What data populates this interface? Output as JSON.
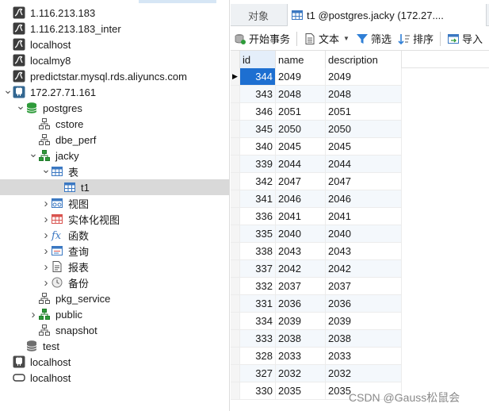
{
  "tree": {
    "nodes": [
      {
        "label": "1.116.213.183",
        "icon": "mysql-connection-icon",
        "level": 0,
        "expander": ""
      },
      {
        "label": "1.116.213.183_inter",
        "icon": "mysql-connection-icon",
        "level": 0,
        "expander": ""
      },
      {
        "label": "localhost",
        "icon": "mysql-connection-icon",
        "level": 0,
        "expander": ""
      },
      {
        "label": "localmy8",
        "icon": "mysql-connection-icon",
        "level": 0,
        "expander": ""
      },
      {
        "label": "predictstar.mysql.rds.aliyuncs.com",
        "icon": "mysql-connection-icon",
        "level": 0,
        "expander": ""
      },
      {
        "label": "172.27.71.161",
        "icon": "postgres-connection-icon",
        "level": 0,
        "expander": "open"
      },
      {
        "label": "postgres",
        "icon": "database-icon",
        "level": 1,
        "expander": "open"
      },
      {
        "label": "cstore",
        "icon": "schema-icon",
        "level": 2,
        "expander": ""
      },
      {
        "label": "dbe_perf",
        "icon": "schema-icon",
        "level": 2,
        "expander": ""
      },
      {
        "label": "jacky",
        "icon": "schema-active-icon",
        "level": 2,
        "expander": "open"
      },
      {
        "label": "表",
        "icon": "tables-icon",
        "level": 3,
        "expander": "open"
      },
      {
        "label": "t1",
        "icon": "table-icon",
        "level": 4,
        "expander": "",
        "selected": true
      },
      {
        "label": "视图",
        "icon": "views-icon",
        "level": 3,
        "expander": "closed"
      },
      {
        "label": "实体化视图",
        "icon": "materialized-views-icon",
        "level": 3,
        "expander": "closed"
      },
      {
        "label": "函数",
        "icon": "function-icon",
        "level": 3,
        "expander": "closed"
      },
      {
        "label": "查询",
        "icon": "query-icon",
        "level": 3,
        "expander": "closed"
      },
      {
        "label": "报表",
        "icon": "report-icon",
        "level": 3,
        "expander": "closed"
      },
      {
        "label": "备份",
        "icon": "backup-icon",
        "level": 3,
        "expander": "closed"
      },
      {
        "label": "pkg_service",
        "icon": "schema-icon",
        "level": 2,
        "expander": ""
      },
      {
        "label": "public",
        "icon": "schema-active-icon",
        "level": 2,
        "expander": "closed"
      },
      {
        "label": "snapshot",
        "icon": "schema-icon",
        "level": 2,
        "expander": ""
      },
      {
        "label": "test",
        "icon": "database-gray-icon",
        "level": 1,
        "expander": ""
      },
      {
        "label": "localhost",
        "icon": "postgres-connection-gray-icon",
        "level": 0,
        "expander": ""
      },
      {
        "label": "localhost",
        "icon": "generic-connection-icon",
        "level": 0,
        "expander": ""
      }
    ]
  },
  "tabs": {
    "objects_label": "对象",
    "active_label": "t1 @postgres.jacky (172.27...."
  },
  "toolbar": {
    "begin_transaction": "开始事务",
    "text": "文本",
    "filter": "筛选",
    "sort": "排序",
    "import": "导入"
  },
  "grid": {
    "columns": [
      "id",
      "name",
      "description"
    ],
    "rows": [
      [
        "344",
        "2049",
        "2049"
      ],
      [
        "343",
        "2048",
        "2048"
      ],
      [
        "346",
        "2051",
        "2051"
      ],
      [
        "345",
        "2050",
        "2050"
      ],
      [
        "340",
        "2045",
        "2045"
      ],
      [
        "339",
        "2044",
        "2044"
      ],
      [
        "342",
        "2047",
        "2047"
      ],
      [
        "341",
        "2046",
        "2046"
      ],
      [
        "336",
        "2041",
        "2041"
      ],
      [
        "335",
        "2040",
        "2040"
      ],
      [
        "338",
        "2043",
        "2043"
      ],
      [
        "337",
        "2042",
        "2042"
      ],
      [
        "332",
        "2037",
        "2037"
      ],
      [
        "331",
        "2036",
        "2036"
      ],
      [
        "334",
        "2039",
        "2039"
      ],
      [
        "333",
        "2038",
        "2038"
      ],
      [
        "328",
        "2033",
        "2033"
      ],
      [
        "327",
        "2032",
        "2032"
      ],
      [
        "330",
        "2035",
        "2035"
      ]
    ],
    "current_row": 0
  },
  "watermark": "CSDN @Gauss松鼠会",
  "colors": {
    "selection": "#1d6fd1",
    "tree_selected": "#d9d9d9",
    "postgres_green": "#2e9b3a",
    "connection_dark": "#3c3c3c",
    "elephant_blue": "#336791"
  }
}
